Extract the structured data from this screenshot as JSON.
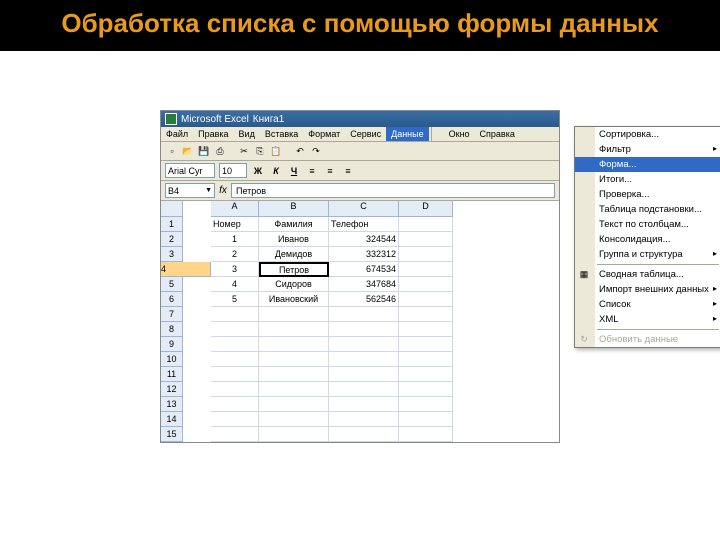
{
  "slide": {
    "title": "Обработка списка с помощью формы данных"
  },
  "window": {
    "app": "Microsoft Excel",
    "doc": "Книга1"
  },
  "menus": [
    "Файл",
    "Правка",
    "Вид",
    "Вставка",
    "Формат",
    "Сервис",
    "Данные",
    "Окно",
    "Справка"
  ],
  "formatbar": {
    "font": "Arial Cyr",
    "size": "10",
    "bold": "Ж",
    "italic": "К",
    "underline": "Ч"
  },
  "namebox": "B4",
  "formula": "Петров",
  "columns": [
    "A",
    "B",
    "C",
    "D"
  ],
  "row_count": 15,
  "selected_row": 4,
  "selected_cell": {
    "row": 4,
    "col": "B"
  },
  "table": {
    "headers": [
      "Номер",
      "Фамилия",
      "Телефон"
    ],
    "rows": [
      {
        "n": "1",
        "fam": "Иванов",
        "tel": "324544"
      },
      {
        "n": "2",
        "fam": "Демидов",
        "tel": "332312"
      },
      {
        "n": "3",
        "fam": "Петров",
        "tel": "674534"
      },
      {
        "n": "4",
        "fam": "Сидоров",
        "tel": "347684"
      },
      {
        "n": "5",
        "fam": "Ивановский",
        "tel": "562546"
      }
    ]
  },
  "dropdown": [
    {
      "label": "Сортировка...",
      "type": "item"
    },
    {
      "label": "Фильтр",
      "type": "sub"
    },
    {
      "label": "Форма...",
      "type": "item",
      "hl": true
    },
    {
      "label": "Итоги...",
      "type": "item"
    },
    {
      "label": "Проверка...",
      "type": "item"
    },
    {
      "label": "Таблица подстановки...",
      "type": "item"
    },
    {
      "label": "Текст по столбцам...",
      "type": "item"
    },
    {
      "label": "Консолидация...",
      "type": "item"
    },
    {
      "label": "Группа и структура",
      "type": "sub"
    },
    {
      "type": "sep"
    },
    {
      "label": "Сводная таблица...",
      "type": "item",
      "icon": "▦"
    },
    {
      "label": "Импорт внешних данных",
      "type": "sub"
    },
    {
      "label": "Список",
      "type": "sub"
    },
    {
      "label": "XML",
      "type": "sub"
    },
    {
      "type": "sep"
    },
    {
      "label": "Обновить данные",
      "type": "item",
      "disabled": true,
      "icon": "↻"
    }
  ],
  "icons": {
    "new": "▫",
    "open": "📂",
    "save": "💾",
    "print": "⎙",
    "cut": "✂",
    "copy": "⎘",
    "paste": "📋",
    "undo": "↶",
    "redo": "↷"
  }
}
